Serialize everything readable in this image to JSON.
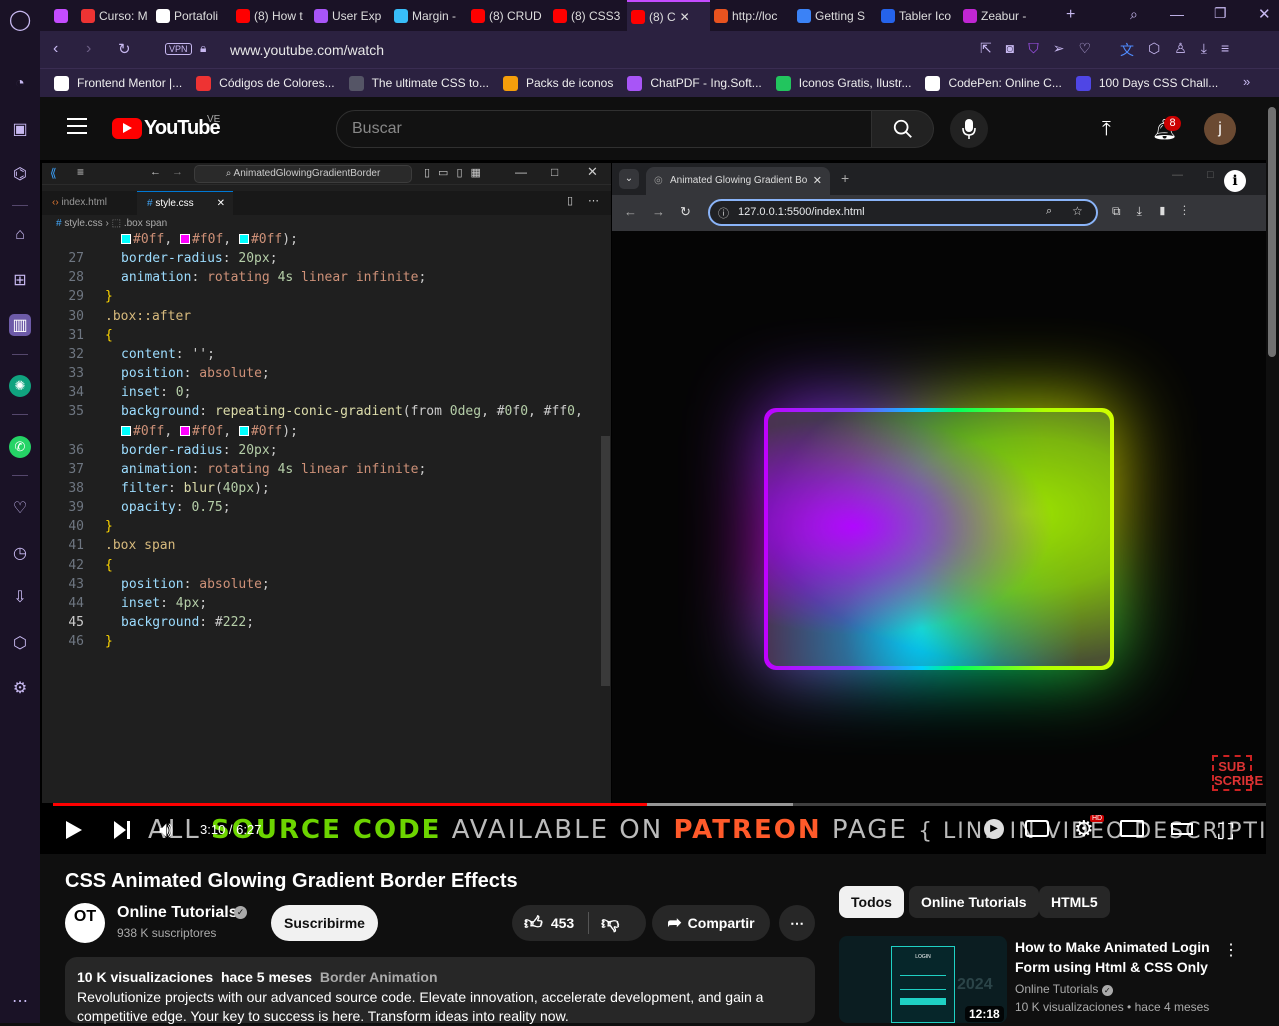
{
  "browser": {
    "tabs": [
      {
        "label": "",
        "color": "#c44cff"
      },
      {
        "label": "Curso: M",
        "color": "#e33"
      },
      {
        "label": "Portafoli",
        "color": "#fff"
      },
      {
        "label": "(8) How t",
        "color": "#f00"
      },
      {
        "label": "User Exp",
        "color": "#a855f7"
      },
      {
        "label": "Margin -",
        "color": "#38bdf8"
      },
      {
        "label": "(8) CRUD",
        "color": "#f00"
      },
      {
        "label": "(8) CSS3",
        "color": "#f00"
      },
      {
        "label": "(8) C",
        "color": "#f00",
        "active": true
      },
      {
        "label": "http://loc",
        "color": "#e8531f"
      },
      {
        "label": "Getting S",
        "color": "#3b82f6"
      },
      {
        "label": "Tabler Ico",
        "color": "#2563eb"
      },
      {
        "label": "Zeabur -",
        "color": "#c026d3"
      }
    ],
    "url": "www.youtube.com/watch",
    "vpn": "VPN",
    "bookmarks": [
      {
        "label": "Frontend Mentor |...",
        "color": "#fff"
      },
      {
        "label": "Códigos de Colores...",
        "color": "#e33"
      },
      {
        "label": "The ultimate CSS to...",
        "color": "#556"
      },
      {
        "label": "Packs de iconos",
        "color": "#f59e0b"
      },
      {
        "label": "ChatPDF - Ing.Soft...",
        "color": "#a855f7"
      },
      {
        "label": "Iconos Gratis, Ilustr...",
        "color": "#22c55e"
      },
      {
        "label": "CodePen: Online C...",
        "color": "#fff"
      },
      {
        "label": "100 Days CSS Chall...",
        "color": "#4f46e5"
      }
    ]
  },
  "youtube": {
    "logo": "YouTube",
    "country": "VE",
    "search_placeholder": "Buscar",
    "notifications": "8",
    "avatar": "j"
  },
  "vscode": {
    "title": "AnimatedGlowingGradientBorder",
    "tabs": [
      "index.html",
      "style.css"
    ],
    "breadcrumb": [
      "style.css",
      ".box span"
    ],
    "lines": [
      {
        "n": "",
        "text": "#0ff, #f0f, #0ff);"
      },
      {
        "n": "27",
        "text": "border-radius: 20px;"
      },
      {
        "n": "28",
        "text": "animation: rotating 4s linear infinite;"
      },
      {
        "n": "29",
        "text": "}"
      },
      {
        "n": "30",
        "text": ".box::after"
      },
      {
        "n": "31",
        "text": "{"
      },
      {
        "n": "32",
        "text": "content: '';"
      },
      {
        "n": "33",
        "text": "position: absolute;"
      },
      {
        "n": "34",
        "text": "inset: 0;"
      },
      {
        "n": "35",
        "text": "background: repeating-conic-gradient(from 0deg, #0f0, #ff0,"
      },
      {
        "n": "",
        "text": "#0ff, #f0f, #0ff);"
      },
      {
        "n": "36",
        "text": "border-radius: 20px;"
      },
      {
        "n": "37",
        "text": "animation: rotating 4s linear infinite;"
      },
      {
        "n": "38",
        "text": "filter: blur(40px);"
      },
      {
        "n": "39",
        "text": "opacity: 0.75;"
      },
      {
        "n": "40",
        "text": "}"
      },
      {
        "n": "41",
        "text": ".box span"
      },
      {
        "n": "42",
        "text": "{"
      },
      {
        "n": "43",
        "text": "position: absolute;"
      },
      {
        "n": "44",
        "text": "inset: 4px;"
      },
      {
        "n": "45",
        "text": "background: #222;"
      },
      {
        "n": "46",
        "text": "}"
      }
    ]
  },
  "inner_browser": {
    "tab_title": "Animated Glowing Gradient Bo",
    "url": "127.0.0.1:5500/index.html"
  },
  "player": {
    "time": "3:10 / 6:27",
    "progress": 0.49,
    "buffered": 0.61,
    "banner": [
      "ALL",
      "SOURCE CODE",
      "AVAILABLE ON",
      "PATREON",
      "PAGE",
      "{ LINK IN VIDEO DESCRIPTION }"
    ],
    "subscribe_badge": "SUB SCRIBE"
  },
  "video_info": {
    "title": "CSS Animated Glowing Gradient Border Effects",
    "channel": "Online Tutorials",
    "subscribers": "938 K suscriptores",
    "subscribe_label": "Suscribirme",
    "likes": "453",
    "share_label": "Compartir",
    "views": "10 K visualizaciones",
    "age": "hace 5 meses",
    "tag": "Border Animation",
    "description": "Revolutionize projects with our advanced source code. Elevate innovation, accelerate development, and gain a competitive edge. Your key to success is here. Transform ideas into reality now."
  },
  "related": {
    "chips": [
      "Todos",
      "Online Tutorials",
      "HTML5"
    ],
    "items": [
      {
        "title": "How to Make Animated Login Form using Html & CSS Only",
        "channel": "Online Tutorials",
        "meta": "10 K visualizaciones • hace 4 meses",
        "duration": "12:18",
        "thumb_text": "LOGIN",
        "thumb_year": "2024"
      }
    ]
  }
}
